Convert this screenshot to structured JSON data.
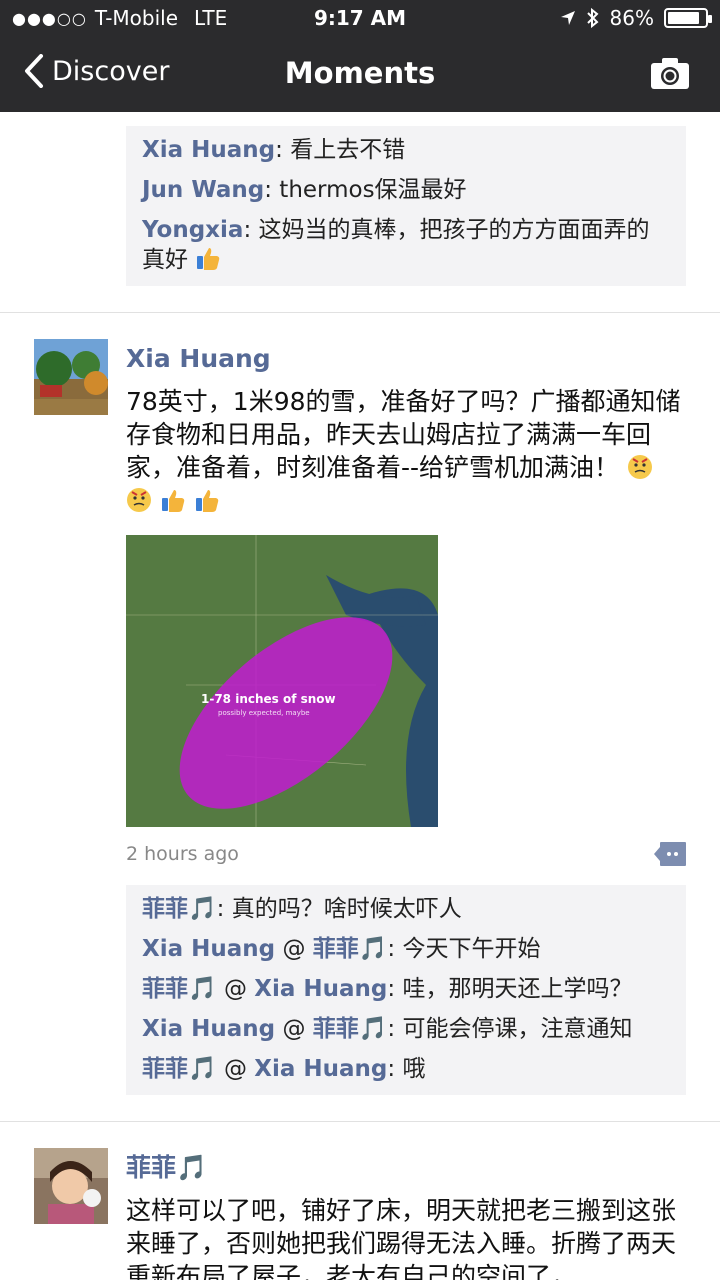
{
  "status_bar": {
    "carrier": "T-Mobile",
    "network": "LTE",
    "time": "9:17 AM",
    "battery": "86%",
    "battery_level": 0.86
  },
  "nav": {
    "back_label": "Discover",
    "title": "Moments"
  },
  "top_comments": [
    {
      "name": "Xia Huang",
      "text": ": 看上去不错"
    },
    {
      "name": "Jun Wang",
      "text": ": thermos保温最好"
    },
    {
      "name": "Yongxia",
      "text": ": 这妈当的真棒，把孩子的方方面面弄的真好"
    }
  ],
  "post1": {
    "author": "Xia Huang",
    "text": "78英寸，1米98的雪，准备好了吗？广播都通知储存食物和日用品，昨天去山姆店拉了满满一车回家，准备着，时刻准备着--给铲雪机加满油！",
    "map": {
      "headline": "1-78 inches of snow",
      "subline": "possibly expected, maybe"
    },
    "time": "2 hours ago",
    "comments": [
      {
        "name": "菲菲🎵",
        "reply_to": "",
        "text": ": 真的吗？啥时候太吓人"
      },
      {
        "name": "Xia Huang",
        "reply_to": "菲菲🎵",
        "text": ": 今天下午开始"
      },
      {
        "name": "菲菲🎵",
        "reply_to": "Xia Huang",
        "text": ": 哇，那明天还上学吗？"
      },
      {
        "name": "Xia Huang",
        "reply_to": "菲菲🎵",
        "text": ": 可能会停课，注意通知"
      },
      {
        "name": "菲菲🎵",
        "reply_to": "Xia Huang",
        "text": ": 哦"
      }
    ]
  },
  "post2": {
    "author": "菲菲🎵",
    "text": "这样可以了吧，铺好了床，明天就把老三搬到这张来睡了，否则她把我们踢得无法入睡。折腾了两天重新布局了屋子，老大有自己的空间了，"
  },
  "colors": {
    "bar": "#2b2b2d",
    "name_link": "#566a96",
    "comment_bg": "#f3f3f5",
    "snow_overlay": "#c21bd0"
  }
}
